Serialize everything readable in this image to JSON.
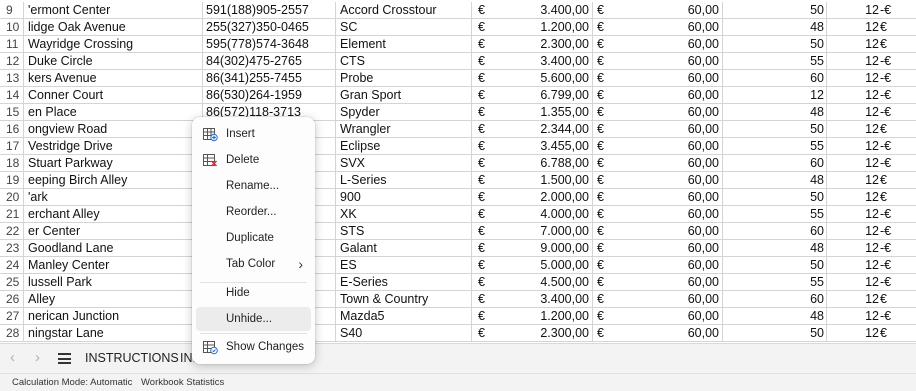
{
  "grid": {
    "rows": [
      {
        "n": "9",
        "a": "'ermont Center",
        "b": "591(188)905-2557",
        "c": "Accord Crosstour",
        "cur": "€",
        "price": "3.400,00",
        "fee": "60,00",
        "f": "50",
        "g": "12",
        "gs": "-€"
      },
      {
        "n": "10",
        "a": "lidge Oak Avenue",
        "b": "255(327)350-0465",
        "c": "SC",
        "cur": "€",
        "price": "1.200,00",
        "fee": "60,00",
        "f": "48",
        "g": "12",
        "gs": "€"
      },
      {
        "n": "11",
        "a": "Wayridge Crossing",
        "b": "595(778)574-3648",
        "c": "Element",
        "cur": "€",
        "price": "2.300,00",
        "fee": "60,00",
        "f": "50",
        "g": "12",
        "gs": "€"
      },
      {
        "n": "12",
        "a": "Duke Circle",
        "b": "84(302)475-2765",
        "c": "CTS",
        "cur": "€",
        "price": "3.400,00",
        "fee": "60,00",
        "f": "55",
        "g": "12",
        "gs": "-€"
      },
      {
        "n": "13",
        "a": "kers Avenue",
        "b": "86(341)255-7455",
        "c": "Probe",
        "cur": "€",
        "price": "5.600,00",
        "fee": "60,00",
        "f": "60",
        "g": "12",
        "gs": "-€"
      },
      {
        "n": "14",
        "a": "Conner Court",
        "b": "86(530)264-1959",
        "c": "Gran Sport",
        "cur": "€",
        "price": "6.799,00",
        "fee": "60,00",
        "f": "12",
        "g": "12",
        "gs": "-€"
      },
      {
        "n": "15",
        "a": "en Place",
        "b": "86(572)118-3713",
        "c": "Spyder",
        "cur": "€",
        "price": "1.355,00",
        "fee": "60,00",
        "f": "48",
        "g": "12",
        "gs": "-€"
      },
      {
        "n": "16",
        "a": "ongview Road",
        "b": "",
        "c": "Wrangler",
        "cur": "€",
        "price": "2.344,00",
        "fee": "60,00",
        "f": "50",
        "g": "12",
        "gs": "€"
      },
      {
        "n": "17",
        "a": "Vestridge Drive",
        "b": "",
        "c": "Eclipse",
        "cur": "€",
        "price": "3.455,00",
        "fee": "60,00",
        "f": "55",
        "g": "12",
        "gs": "-€"
      },
      {
        "n": "18",
        "a": "Stuart Parkway",
        "b": "",
        "c": "SVX",
        "cur": "€",
        "price": "6.788,00",
        "fee": "60,00",
        "f": "60",
        "g": "12",
        "gs": "-€"
      },
      {
        "n": "19",
        "a": "eeping Birch Alley",
        "b": "",
        "c": "L-Series",
        "cur": "€",
        "price": "1.500,00",
        "fee": "60,00",
        "f": "48",
        "g": "12",
        "gs": "€"
      },
      {
        "n": "20",
        "a": "'ark",
        "b": "",
        "c": "900",
        "cur": "€",
        "price": "2.000,00",
        "fee": "60,00",
        "f": "50",
        "g": "12",
        "gs": "€"
      },
      {
        "n": "21",
        "a": "erchant Alley",
        "b": "",
        "c": "XK",
        "cur": "€",
        "price": "4.000,00",
        "fee": "60,00",
        "f": "55",
        "g": "12",
        "gs": "-€"
      },
      {
        "n": "22",
        "a": "er Center",
        "b": "",
        "c": "STS",
        "cur": "€",
        "price": "7.000,00",
        "fee": "60,00",
        "f": "60",
        "g": "12",
        "gs": "-€"
      },
      {
        "n": "23",
        "a": "Goodland Lane",
        "b": "",
        "c": "Galant",
        "cur": "€",
        "price": "9.000,00",
        "fee": "60,00",
        "f": "48",
        "g": "12",
        "gs": "-€"
      },
      {
        "n": "24",
        "a": "Manley Center",
        "b": "",
        "c": "ES",
        "cur": "€",
        "price": "5.000,00",
        "fee": "60,00",
        "f": "50",
        "g": "12",
        "gs": "-€"
      },
      {
        "n": "25",
        "a": "lussell Park",
        "b": "",
        "c": "E-Series",
        "cur": "€",
        "price": "4.500,00",
        "fee": "60,00",
        "f": "55",
        "g": "12",
        "gs": "-€"
      },
      {
        "n": "26",
        "a": "Alley",
        "b": "",
        "c": "Town & Country",
        "cur": "€",
        "price": "3.400,00",
        "fee": "60,00",
        "f": "60",
        "g": "12",
        "gs": "€"
      },
      {
        "n": "27",
        "a": "nerican Junction",
        "b": "",
        "c": "Mazda5",
        "cur": "€",
        "price": "1.200,00",
        "fee": "60,00",
        "f": "48",
        "g": "12",
        "gs": "-€"
      },
      {
        "n": "28",
        "a": "ningstar Lane",
        "b": "",
        "c": "S40",
        "cur": "€",
        "price": "2.300,00",
        "fee": "60,00",
        "f": "50",
        "g": "12",
        "gs": "€"
      }
    ]
  },
  "context_menu": {
    "insert": "Insert",
    "delete": "Delete",
    "rename": "Rename...",
    "reorder": "Reorder...",
    "duplicate": "Duplicate",
    "tab_color": "Tab Color",
    "hide": "Hide",
    "unhide": "Unhide...",
    "show_changes": "Show Changes"
  },
  "tabs": {
    "sheet1": "INSTRUCTIONS",
    "sheet2": "INI"
  },
  "status": {
    "calc_mode": "Calculation Mode: Automatic",
    "workbook_stats": "Workbook Statistics"
  },
  "colors": {
    "grid_line": "#d4d4d4",
    "menu_highlight": "#ececec",
    "icon_blue": "#2b6cc4",
    "icon_red": "#d13438"
  }
}
